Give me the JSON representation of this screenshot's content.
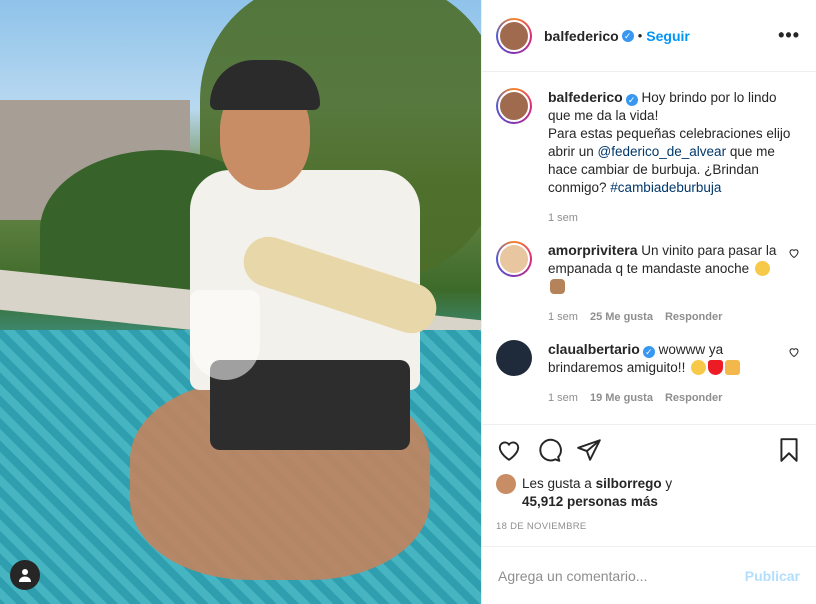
{
  "post": {
    "author": {
      "username": "balfederico",
      "verified": true,
      "follow_label": "Seguir",
      "separator": "•"
    },
    "more_icon": "more-horizontal-icon",
    "caption": {
      "username": "balfederico",
      "text_1": "Hoy brindo por lo lindo que me da la vida!",
      "text_2": "Para estas pequeñas celebraciones elijo abrir un ",
      "mention": "@federico_de_alvear",
      "text_3": " que me hace cambiar de burbuja. ¿Brindan conmigo? ",
      "hashtag": "#cambiadeburbuja",
      "time": "1 sem"
    },
    "comments": [
      {
        "username": "amorprivitera",
        "verified": false,
        "text": "Un vinito para pasar la empanada q te mandaste anoche",
        "time": "1 sem",
        "likes": "25 Me gusta",
        "reply": "Responder"
      },
      {
        "username": "claualbertario",
        "verified": true,
        "text": "wowww ya brindaremos amiguito!!",
        "time": "1 sem",
        "likes": "19 Me gusta",
        "reply": "Responder"
      }
    ],
    "likes": {
      "prefix": "Les gusta a ",
      "user": "silborrego",
      "conj": " y",
      "count": "45,912 personas más"
    },
    "date": "18 DE NOVIEMBRE",
    "add_comment": {
      "placeholder": "Agrega un comentario...",
      "publish": "Publicar"
    }
  },
  "colors": {
    "accent": "#0095f6",
    "verified": "#3897f0",
    "muted": "#8e8e8e",
    "publish_disabled": "#b2dffc"
  }
}
